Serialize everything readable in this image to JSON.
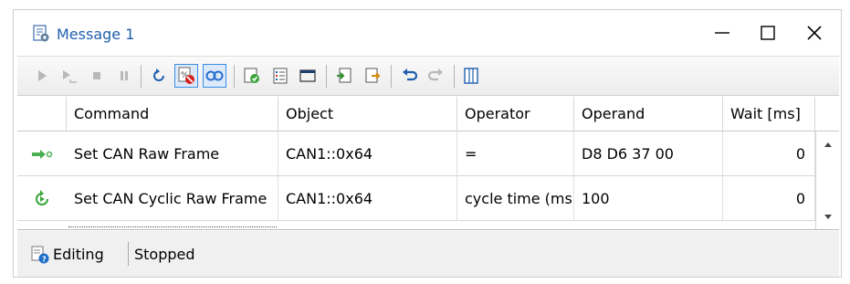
{
  "window": {
    "title": "Message 1",
    "minimize_glyph": "—",
    "close_glyph": "✕"
  },
  "toolbar": {
    "buttons": [
      {
        "name": "play-icon"
      },
      {
        "name": "step-icon"
      },
      {
        "name": "stop-icon"
      },
      {
        "name": "pause-icon"
      },
      {
        "name": "reset-icon"
      },
      {
        "name": "disable-message-icon",
        "toggled": true
      },
      {
        "name": "loop-icon",
        "toggled": true
      },
      {
        "name": "check-document-icon"
      },
      {
        "name": "properties-icon"
      },
      {
        "name": "folder-icon"
      },
      {
        "name": "import-icon"
      },
      {
        "name": "export-icon"
      },
      {
        "name": "undo-icon"
      },
      {
        "name": "redo-icon"
      },
      {
        "name": "columns-icon"
      }
    ]
  },
  "grid": {
    "columns": [
      "Command",
      "Object",
      "Operator",
      "Operand",
      "Wait [ms]"
    ],
    "rows": [
      {
        "icon": "send-arrow-icon",
        "command": "Set CAN Raw Frame",
        "object": "CAN1::0x64",
        "operator": "=",
        "operand": "D8 D6 37 00",
        "wait": "0"
      },
      {
        "icon": "cyclic-icon",
        "command": "Set CAN Cyclic Raw Frame",
        "object": "CAN1::0x64",
        "operator": "cycle time (ms)",
        "operand": "100",
        "wait": "0"
      }
    ]
  },
  "status": {
    "mode": "Editing",
    "state": "Stopped"
  },
  "colors": {
    "title_blue": "#1f5fae",
    "toggle_border": "#3a8ee6",
    "arrow_green": "#4caf50"
  }
}
